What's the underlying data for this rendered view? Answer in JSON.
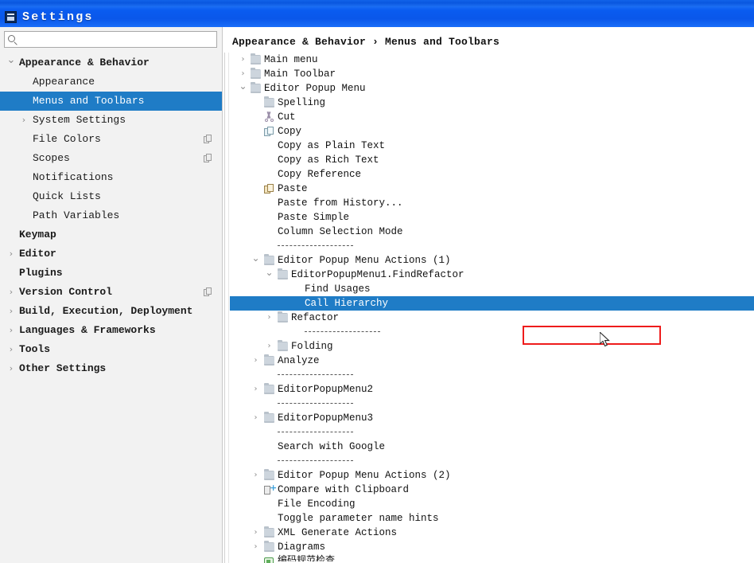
{
  "window": {
    "title": "Settings",
    "app_icon": "window-icon",
    "titlebar_color": "#0a57ea"
  },
  "theme": {
    "selection_blue": "#1f7cc6",
    "sidebar_bg": "#f2f2f2",
    "annotation_red": "#ee1c1c"
  },
  "search": {
    "value": "",
    "placeholder": "",
    "icon": "search-icon"
  },
  "sidebar": {
    "items": [
      {
        "label": "Appearance & Behavior",
        "indent": 0,
        "arrow": "chevron-down",
        "bold": true,
        "selected": false,
        "copy": false
      },
      {
        "label": "Appearance",
        "indent": 1,
        "arrow": "",
        "bold": false,
        "selected": false,
        "copy": false
      },
      {
        "label": "Menus and Toolbars",
        "indent": 1,
        "arrow": "",
        "bold": false,
        "selected": true,
        "copy": false
      },
      {
        "label": "System Settings",
        "indent": 1,
        "arrow": "chevron-right",
        "bold": false,
        "selected": false,
        "copy": false
      },
      {
        "label": "File Colors",
        "indent": 1,
        "arrow": "",
        "bold": false,
        "selected": false,
        "copy": true
      },
      {
        "label": "Scopes",
        "indent": 1,
        "arrow": "",
        "bold": false,
        "selected": false,
        "copy": true
      },
      {
        "label": "Notifications",
        "indent": 1,
        "arrow": "",
        "bold": false,
        "selected": false,
        "copy": false
      },
      {
        "label": "Quick Lists",
        "indent": 1,
        "arrow": "",
        "bold": false,
        "selected": false,
        "copy": false
      },
      {
        "label": "Path Variables",
        "indent": 1,
        "arrow": "",
        "bold": false,
        "selected": false,
        "copy": false
      },
      {
        "label": "Keymap",
        "indent": 0,
        "arrow": "",
        "bold": true,
        "selected": false,
        "copy": false
      },
      {
        "label": "Editor",
        "indent": 0,
        "arrow": "chevron-right",
        "bold": true,
        "selected": false,
        "copy": false
      },
      {
        "label": "Plugins",
        "indent": 0,
        "arrow": "",
        "bold": true,
        "selected": false,
        "copy": false
      },
      {
        "label": "Version Control",
        "indent": 0,
        "arrow": "chevron-right",
        "bold": true,
        "selected": false,
        "copy": true
      },
      {
        "label": "Build, Execution, Deployment",
        "indent": 0,
        "arrow": "chevron-right",
        "bold": true,
        "selected": false,
        "copy": false
      },
      {
        "label": "Languages & Frameworks",
        "indent": 0,
        "arrow": "chevron-right",
        "bold": true,
        "selected": false,
        "copy": false
      },
      {
        "label": "Tools",
        "indent": 0,
        "arrow": "chevron-right",
        "bold": true,
        "selected": false,
        "copy": false
      },
      {
        "label": "Other Settings",
        "indent": 0,
        "arrow": "chevron-right",
        "bold": true,
        "selected": false,
        "copy": false
      }
    ]
  },
  "breadcrumb": {
    "text": "Appearance & Behavior › Menus and Toolbars",
    "parts": [
      "Appearance & Behavior",
      "Menus and Toolbars"
    ],
    "separator": "›"
  },
  "annotation": {
    "red_box_target": "Call Hierarchy",
    "cursor": "arrow-pointer"
  },
  "tree": {
    "rows": [
      {
        "label": "Main menu",
        "indent": 0,
        "arrow": "chevron-right",
        "icon": "folder",
        "selected": false
      },
      {
        "label": "Main Toolbar",
        "indent": 0,
        "arrow": "chevron-right",
        "icon": "folder",
        "selected": false
      },
      {
        "label": "Editor Popup Menu",
        "indent": 0,
        "arrow": "chevron-down",
        "icon": "folder",
        "selected": false
      },
      {
        "label": "Spelling",
        "indent": 1,
        "arrow": "",
        "icon": "folder",
        "selected": false
      },
      {
        "label": "Cut",
        "indent": 1,
        "arrow": "",
        "icon": "cut",
        "selected": false
      },
      {
        "label": "Copy",
        "indent": 1,
        "arrow": "",
        "icon": "copy",
        "selected": false
      },
      {
        "label": "Copy as Plain Text",
        "indent": 1,
        "arrow": "",
        "icon": "",
        "selected": false
      },
      {
        "label": "Copy as Rich Text",
        "indent": 1,
        "arrow": "",
        "icon": "",
        "selected": false
      },
      {
        "label": "Copy Reference",
        "indent": 1,
        "arrow": "",
        "icon": "",
        "selected": false
      },
      {
        "label": "Paste",
        "indent": 1,
        "arrow": "",
        "icon": "paste",
        "selected": false
      },
      {
        "label": "Paste from History...",
        "indent": 1,
        "arrow": "",
        "icon": "",
        "selected": false
      },
      {
        "label": "Paste Simple",
        "indent": 1,
        "arrow": "",
        "icon": "",
        "selected": false
      },
      {
        "label": "Column Selection Mode",
        "indent": 1,
        "arrow": "",
        "icon": "",
        "selected": false
      },
      {
        "label": "",
        "indent": 1,
        "arrow": "",
        "icon": "sep",
        "selected": false
      },
      {
        "label": "Editor Popup Menu Actions (1)",
        "indent": 1,
        "arrow": "chevron-down",
        "icon": "folder",
        "selected": false
      },
      {
        "label": "EditorPopupMenu1.FindRefactor",
        "indent": 2,
        "arrow": "chevron-down",
        "icon": "folder",
        "selected": false
      },
      {
        "label": "Find Usages",
        "indent": 3,
        "arrow": "",
        "icon": "",
        "selected": false
      },
      {
        "label": "Call Hierarchy",
        "indent": 3,
        "arrow": "",
        "icon": "",
        "selected": true
      },
      {
        "label": "Refactor",
        "indent": 2,
        "arrow": "chevron-right",
        "icon": "folder",
        "selected": false
      },
      {
        "label": "",
        "indent": 3,
        "arrow": "",
        "icon": "sep",
        "selected": false
      },
      {
        "label": "Folding",
        "indent": 2,
        "arrow": "chevron-right",
        "icon": "folder",
        "selected": false
      },
      {
        "label": "Analyze",
        "indent": 1,
        "arrow": "chevron-right",
        "icon": "folder",
        "selected": false
      },
      {
        "label": "",
        "indent": 1,
        "arrow": "",
        "icon": "sep",
        "selected": false
      },
      {
        "label": "EditorPopupMenu2",
        "indent": 1,
        "arrow": "chevron-right",
        "icon": "folder",
        "selected": false
      },
      {
        "label": "",
        "indent": 1,
        "arrow": "",
        "icon": "sep",
        "selected": false
      },
      {
        "label": "EditorPopupMenu3",
        "indent": 1,
        "arrow": "chevron-right",
        "icon": "folder",
        "selected": false
      },
      {
        "label": "",
        "indent": 1,
        "arrow": "",
        "icon": "sep",
        "selected": false
      },
      {
        "label": "Search with Google",
        "indent": 1,
        "arrow": "",
        "icon": "",
        "selected": false
      },
      {
        "label": "",
        "indent": 1,
        "arrow": "",
        "icon": "sep",
        "selected": false
      },
      {
        "label": "Editor Popup Menu Actions (2)",
        "indent": 1,
        "arrow": "chevron-right",
        "icon": "folder",
        "selected": false
      },
      {
        "label": "Compare with Clipboard",
        "indent": 1,
        "arrow": "",
        "icon": "compare",
        "selected": false
      },
      {
        "label": "File Encoding",
        "indent": 1,
        "arrow": "",
        "icon": "",
        "selected": false
      },
      {
        "label": "Toggle parameter name hints",
        "indent": 1,
        "arrow": "",
        "icon": "",
        "selected": false
      },
      {
        "label": "XML Generate Actions",
        "indent": 1,
        "arrow": "chevron-right",
        "icon": "folder",
        "selected": false
      },
      {
        "label": "Diagrams",
        "indent": 1,
        "arrow": "chevron-right",
        "icon": "folder",
        "selected": false
      },
      {
        "label": "编码规范检查",
        "indent": 1,
        "arrow": "",
        "icon": "green",
        "selected": false,
        "clipped": true
      }
    ]
  }
}
